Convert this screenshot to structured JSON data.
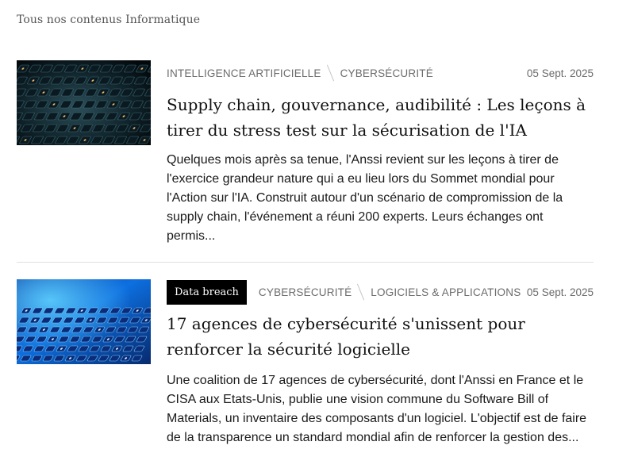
{
  "section": {
    "label": "Tous nos contenus Informatique"
  },
  "articles": [
    {
      "image_icon": "dark-keyboard-image",
      "badge": "",
      "tags": [
        "INTELLIGENCE ARTIFICIELLE",
        "CYBERSÉCURITÉ"
      ],
      "date": "05 Sept. 2025",
      "title": "Supply chain, gouvernance, audibilité : Les leçons à tirer du stress test sur la sécurisation de l'IA",
      "excerpt": "Quelques mois après sa tenue, l'Anssi revient sur les leçons à tirer de l'exercice grandeur nature qui a eu lieu lors du Sommet mondial pour l'Action sur l'IA. Construit autour d'un scénario de compromission de la supply chain, l'événement a réuni 200 experts. Leurs échanges ont permis..."
    },
    {
      "image_icon": "blue-keyboard-image",
      "badge": "Data breach",
      "tags": [
        "CYBERSÉCURITÉ",
        "LOGICIELS & APPLICATIONS"
      ],
      "date": "05 Sept. 2025",
      "title": "17 agences de cybersécurité s'unissent pour renforcer la sécurité logicielle",
      "excerpt": "Une coalition de 17 agences de cybersécurité, dont l'Anssi en France et le CISA aux Etats-Unis, publie une vision commune du Software Bill of Materials, un inventaire des composants d'un logiciel. L'objectif est de faire de la transparence un standard mondial afin de renforcer la gestion des..."
    }
  ],
  "colors": {
    "badge_bg": "#000000",
    "tag_text": "#6b6b6b",
    "divider": "#e0e0e0"
  }
}
